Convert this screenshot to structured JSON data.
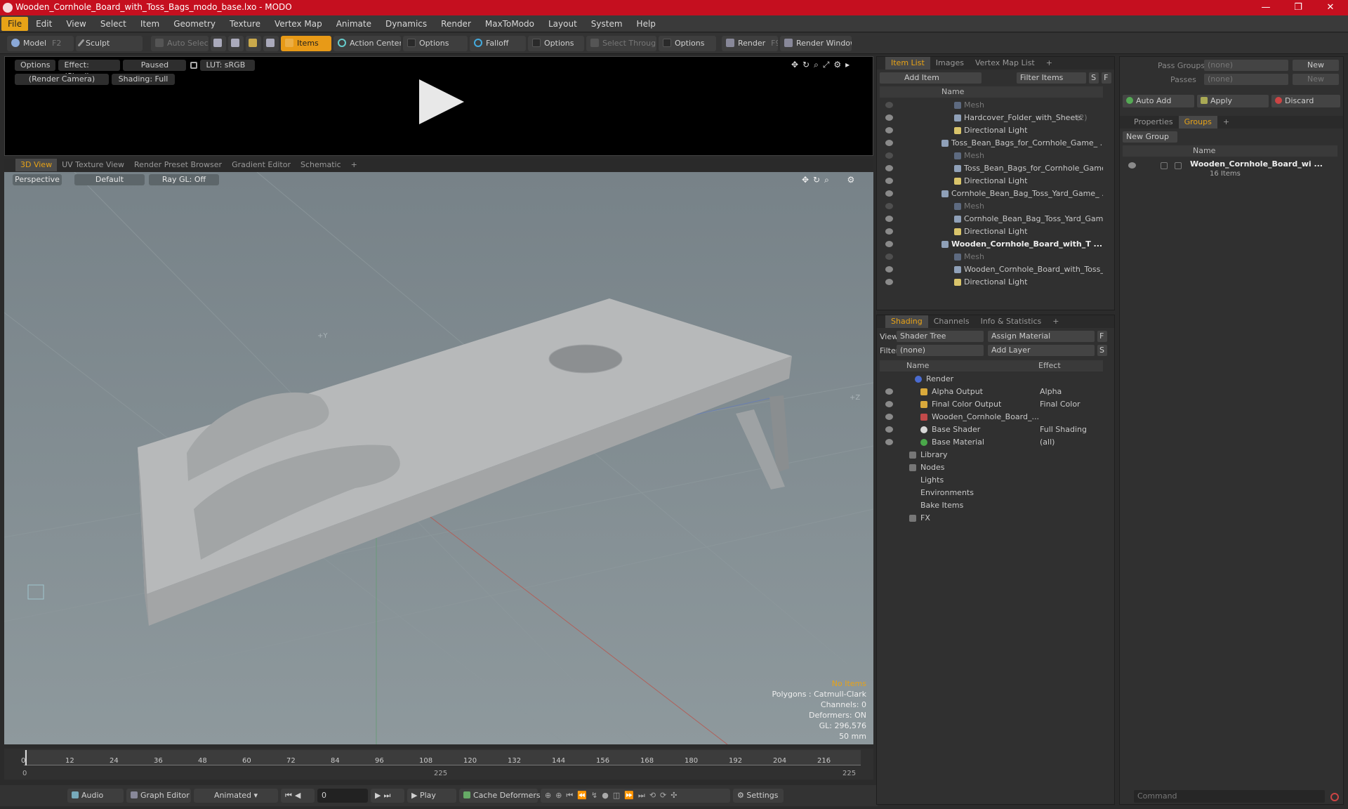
{
  "window": {
    "title": "Wooden_Cornhole_Board_with_Toss_Bags_modo_base.lxo - MODO",
    "minimize": "—",
    "maximize": "❐",
    "close": "✕"
  },
  "menu": [
    "File",
    "Edit",
    "View",
    "Select",
    "Item",
    "Geometry",
    "Texture",
    "Vertex Map",
    "Animate",
    "Dynamics",
    "Render",
    "MaxToModo",
    "Layout",
    "System",
    "Help"
  ],
  "toolbar": {
    "model": "Model",
    "model_shortcut": "F2",
    "sculpt": "Sculpt",
    "auto_select": "Auto Select",
    "items": "Items",
    "action_center": "Action Center",
    "options1": "Options",
    "falloff": "Falloff",
    "options2": "Options",
    "select_through": "Select Through",
    "options3": "Options",
    "render": "Render",
    "render_shortcut": "F9",
    "render_window": "Render Window"
  },
  "preview": {
    "options": "Options",
    "effect": "Effect: (Shadi...",
    "paused": "Paused",
    "lut": "LUT: sRGB",
    "camera": "(Render Camera)",
    "shading": "Shading: Full"
  },
  "viewport_tabs": [
    "3D View",
    "UV Texture View",
    "Render Preset Browser",
    "Gradient Editor",
    "Schematic",
    "+"
  ],
  "viewport": {
    "perspective": "Perspective",
    "default": "Default",
    "raygl": "Ray GL: Off",
    "axis_y": "+Y",
    "axis_z": "+Z",
    "stats": {
      "no_items": "No Items",
      "polygons": "Polygons : Catmull-Clark",
      "channels": "Channels: 0",
      "deformers": "Deformers: ON",
      "gl": "GL: 296,576",
      "focal": "50 mm"
    }
  },
  "timeline": {
    "ticks": [
      "0",
      "12",
      "24",
      "36",
      "48",
      "60",
      "72",
      "84",
      "96",
      "108",
      "120",
      "132",
      "144",
      "156",
      "168",
      "180",
      "192",
      "204",
      "216"
    ],
    "start": "0",
    "mid": "225",
    "end": "225"
  },
  "bottom": {
    "audio": "Audio",
    "graph_editor": "Graph Editor",
    "animated": "Animated",
    "frame": "0",
    "play": "Play",
    "cache_deformers": "Cache Deformers",
    "settings": "Settings"
  },
  "item_list": {
    "tabs": [
      "Item List",
      "Images",
      "Vertex Map List",
      "+"
    ],
    "add_item": "Add Item",
    "filter_items": "Filter Items",
    "name_col": "Name",
    "rows": [
      {
        "label": "Mesh",
        "dim": true
      },
      {
        "label": "Hardcover_Folder_with_Sheets",
        "count": "(2)"
      },
      {
        "label": "Directional Light"
      },
      {
        "label": "Toss_Bean_Bags_for_Cornhole_Game_ ..."
      },
      {
        "label": "Mesh",
        "dim": true
      },
      {
        "label": "Toss_Bean_Bags_for_Cornhole_Game...."
      },
      {
        "label": "Directional Light"
      },
      {
        "label": "Cornhole_Bean_Bag_Toss_Yard_Game_ ..."
      },
      {
        "label": "Mesh",
        "dim": true
      },
      {
        "label": "Cornhole_Bean_Bag_Toss_Yard_Gam ..."
      },
      {
        "label": "Directional Light"
      },
      {
        "label": "Wooden_Cornhole_Board_with_T ...",
        "bold": true
      },
      {
        "label": "Mesh",
        "dim": true
      },
      {
        "label": "Wooden_Cornhole_Board_with_Toss_..."
      },
      {
        "label": "Directional Light"
      }
    ]
  },
  "shading": {
    "tabs": [
      "Shading",
      "Channels",
      "Info & Statistics",
      "+"
    ],
    "view_label": "View",
    "view_value": "Shader Tree",
    "assign_material": "Assign Material",
    "filter_label": "Filter",
    "filter_value": "(none)",
    "add_layer": "Add Layer",
    "name_col": "Name",
    "effect_col": "Effect",
    "rows": [
      {
        "label": "Render",
        "effect": ""
      },
      {
        "label": "Alpha Output",
        "effect": "Alpha"
      },
      {
        "label": "Final Color Output",
        "effect": "Final Color"
      },
      {
        "label": "Wooden_Cornhole_Board_...",
        "effect": ""
      },
      {
        "label": "Base Shader",
        "effect": "Full Shading"
      },
      {
        "label": "Base Material",
        "effect": "(all)"
      },
      {
        "label": "Library",
        "effect": ""
      },
      {
        "label": "Nodes",
        "effect": ""
      },
      {
        "label": "Lights",
        "effect": ""
      },
      {
        "label": "Environments",
        "effect": ""
      },
      {
        "label": "Bake Items",
        "effect": ""
      },
      {
        "label": "FX",
        "effect": ""
      }
    ]
  },
  "groups_panel": {
    "pass_groups_label": "Pass Groups",
    "pass_groups_value": "(none)",
    "new": "New",
    "passes_label": "Passes",
    "passes_value": "(none)",
    "new2": "New",
    "auto_add": "Auto Add",
    "apply": "Apply",
    "discard": "Discard",
    "tabs": [
      "Properties",
      "Groups",
      "+"
    ],
    "new_group": "New Group",
    "name_col": "Name",
    "group_name": "Wooden_Cornhole_Board_wi ...",
    "group_count": "16 Items",
    "command_placeholder": "Command"
  },
  "colors": {
    "accent": "#e8a317",
    "titlebar": "#c50f1f"
  }
}
